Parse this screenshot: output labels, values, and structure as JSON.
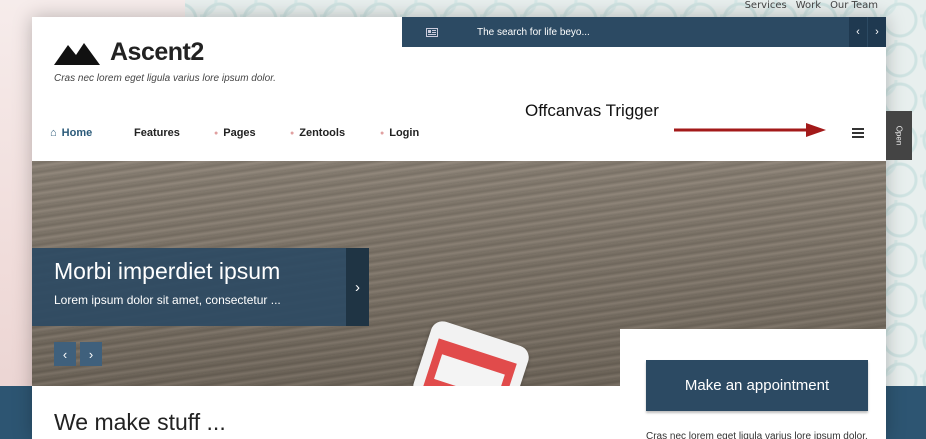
{
  "top_links": [
    "Services",
    "Work",
    "Our Team"
  ],
  "logo": {
    "text": "Ascent2",
    "tagline": "Cras nec lorem eget ligula varius lore ipsum dolor."
  },
  "ticker": {
    "text": "The search for life beyo...",
    "prev_icon": "chevron-left-icon",
    "next_icon": "chevron-right-icon"
  },
  "menu": {
    "items": [
      {
        "label": "Home",
        "icon": "home-icon",
        "active": true
      },
      {
        "label": "Features"
      },
      {
        "label": "Pages"
      },
      {
        "label": "Zentools"
      },
      {
        "label": "Login"
      }
    ]
  },
  "annotation": {
    "text": "Offcanvas Trigger",
    "arrow_color": "#a31a1a"
  },
  "offcanvas_tab": {
    "label": "Open"
  },
  "hero": {
    "title": "Morbi imperdiet ipsum",
    "subtitle": "Lorem ipsum dolor sit amet, consectetur ..."
  },
  "section": {
    "title": "We make stuff ..."
  },
  "appointment": {
    "button_label": "Make an appointment",
    "text": "Cras nec lorem eget ligula varius lore ipsum dolor."
  },
  "colors": {
    "primary": "#2c4a63",
    "accent_dot": "#e0a0a0"
  }
}
